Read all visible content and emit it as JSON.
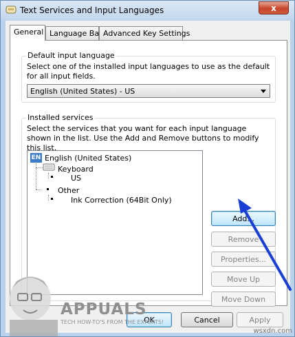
{
  "window": {
    "title": "Text Services and Input Languages",
    "close_glyph": "x"
  },
  "tabs": [
    {
      "label": "General",
      "active": true
    },
    {
      "label": "Language Bar",
      "active": false
    },
    {
      "label": "Advanced Key Settings",
      "active": false
    }
  ],
  "default_lang": {
    "group_label": "Default input language",
    "description": "Select one of the installed input languages to use as the default for all input fields.",
    "selected": "English (United States) - US"
  },
  "installed": {
    "group_label": "Installed services",
    "description": "Select the services that you want for each input language shown in the list. Use the Add and Remove buttons to modify this list.",
    "tree": {
      "lang_badge": "EN",
      "language": "English (United States)",
      "keyboard": "Keyboard",
      "keyboard_item": "US",
      "other": "Other",
      "other_item": "Ink Correction (64Bit Only)"
    },
    "buttons": {
      "add": "Add...",
      "remove": "Remove",
      "properties": "Properties...",
      "move_up": "Move Up",
      "move_down": "Move Down"
    }
  },
  "footer": {
    "ok": "OK",
    "cancel": "Cancel",
    "apply": "Apply"
  },
  "watermark": {
    "brand": "APPUALS",
    "tagline": "TECH HOW-TO'S FROM THE EXPERTS!",
    "site": "wsxdn.com"
  },
  "colors": {
    "arrow": "#1a3fd6",
    "lang_badge": "#3d7cc9"
  }
}
